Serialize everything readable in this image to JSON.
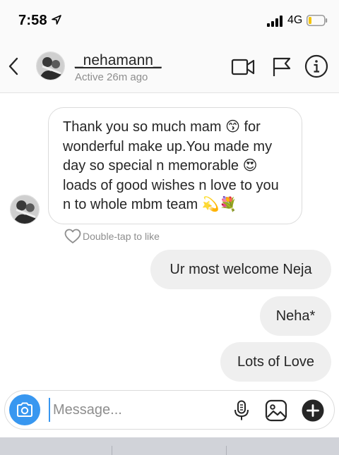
{
  "status_bar": {
    "time": "7:58",
    "network": "4G"
  },
  "header": {
    "username": "_nehamann_",
    "status": "Active 26m ago"
  },
  "messages": {
    "received": {
      "text": "Thank you so much mam 😙 for wonderful make up.You made my day so special n memorable 😍 loads of good wishes n love to you n to whole mbm team 💫💐"
    },
    "like_hint": "Double-tap to like",
    "sent": [
      {
        "text": "Ur most welcome Neja"
      },
      {
        "text": "Neha*"
      },
      {
        "text": "Lots of Love"
      }
    ]
  },
  "composer": {
    "placeholder": "Message..."
  },
  "colors": {
    "accent": "#3897f0",
    "sent_bubble": "#efefef",
    "muted_text": "#8e8e8e"
  }
}
